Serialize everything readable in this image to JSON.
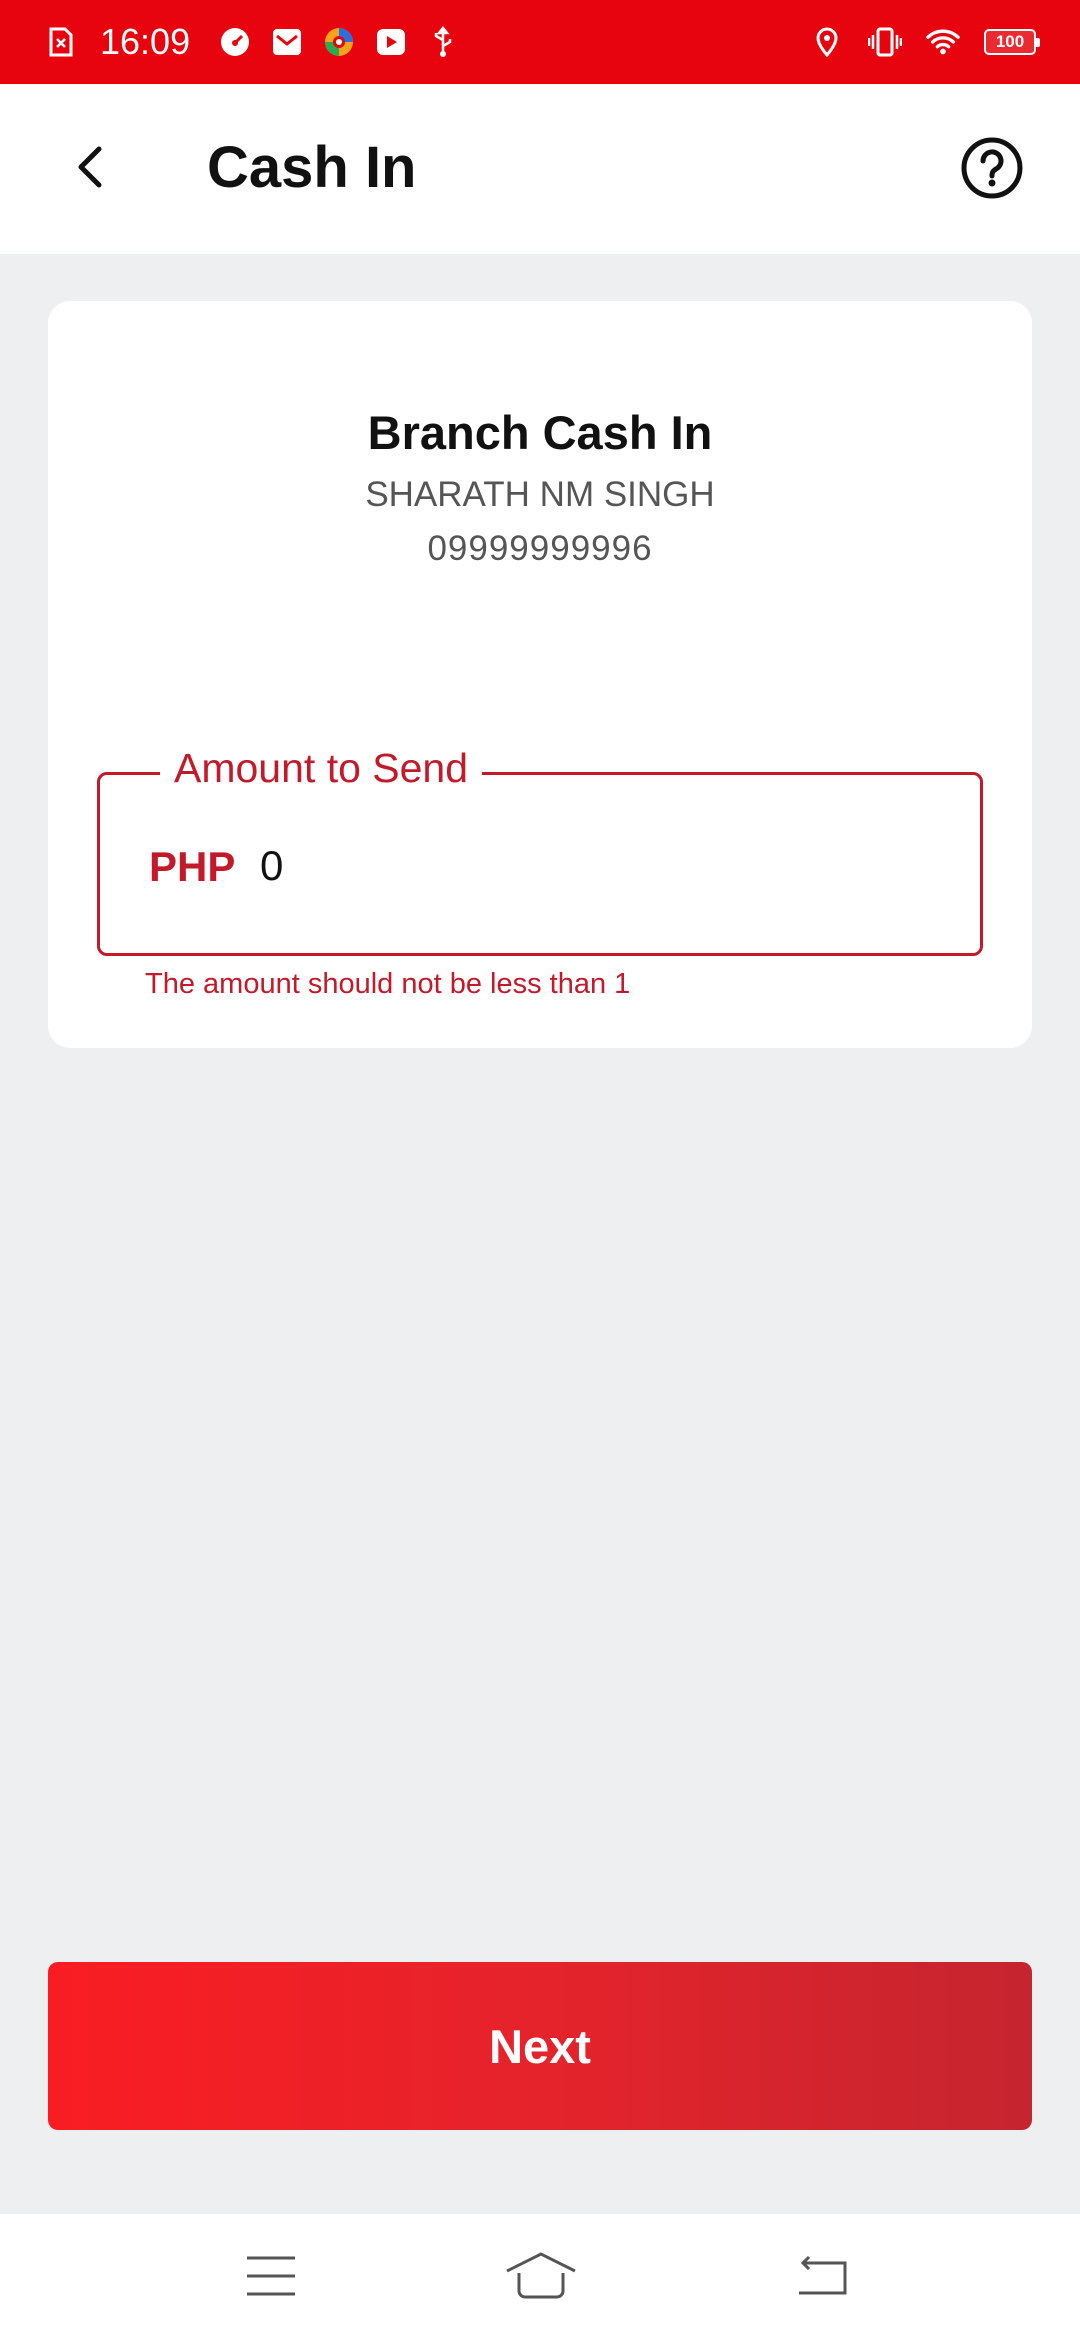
{
  "status_bar": {
    "time": "16:09",
    "battery": "100",
    "left_icons": [
      "sim-off-icon",
      "speedometer-icon",
      "mail-icon",
      "browser-icon",
      "youtube-icon",
      "usb-icon"
    ],
    "right_icons": [
      "location-icon",
      "vibrate-icon",
      "wifi-icon",
      "battery-icon"
    ]
  },
  "app_bar": {
    "title": "Cash In",
    "back_icon": "chevron-left-icon",
    "help_icon": "help-circle-icon"
  },
  "card": {
    "title": "Branch Cash In",
    "name": "SHARATH NM SINGH",
    "number": "09999999996"
  },
  "amount_field": {
    "label": "Amount to Send",
    "currency": "PHP",
    "value": "0",
    "error": "The amount should not be less than 1"
  },
  "next_button": {
    "label": "Next"
  },
  "colors": {
    "status_bar": "#e8040e",
    "accent": "#c21a2a",
    "background": "#eeeff1"
  },
  "nav_bar": {
    "icons": [
      "menu-icon",
      "home-icon",
      "back-icon"
    ]
  }
}
